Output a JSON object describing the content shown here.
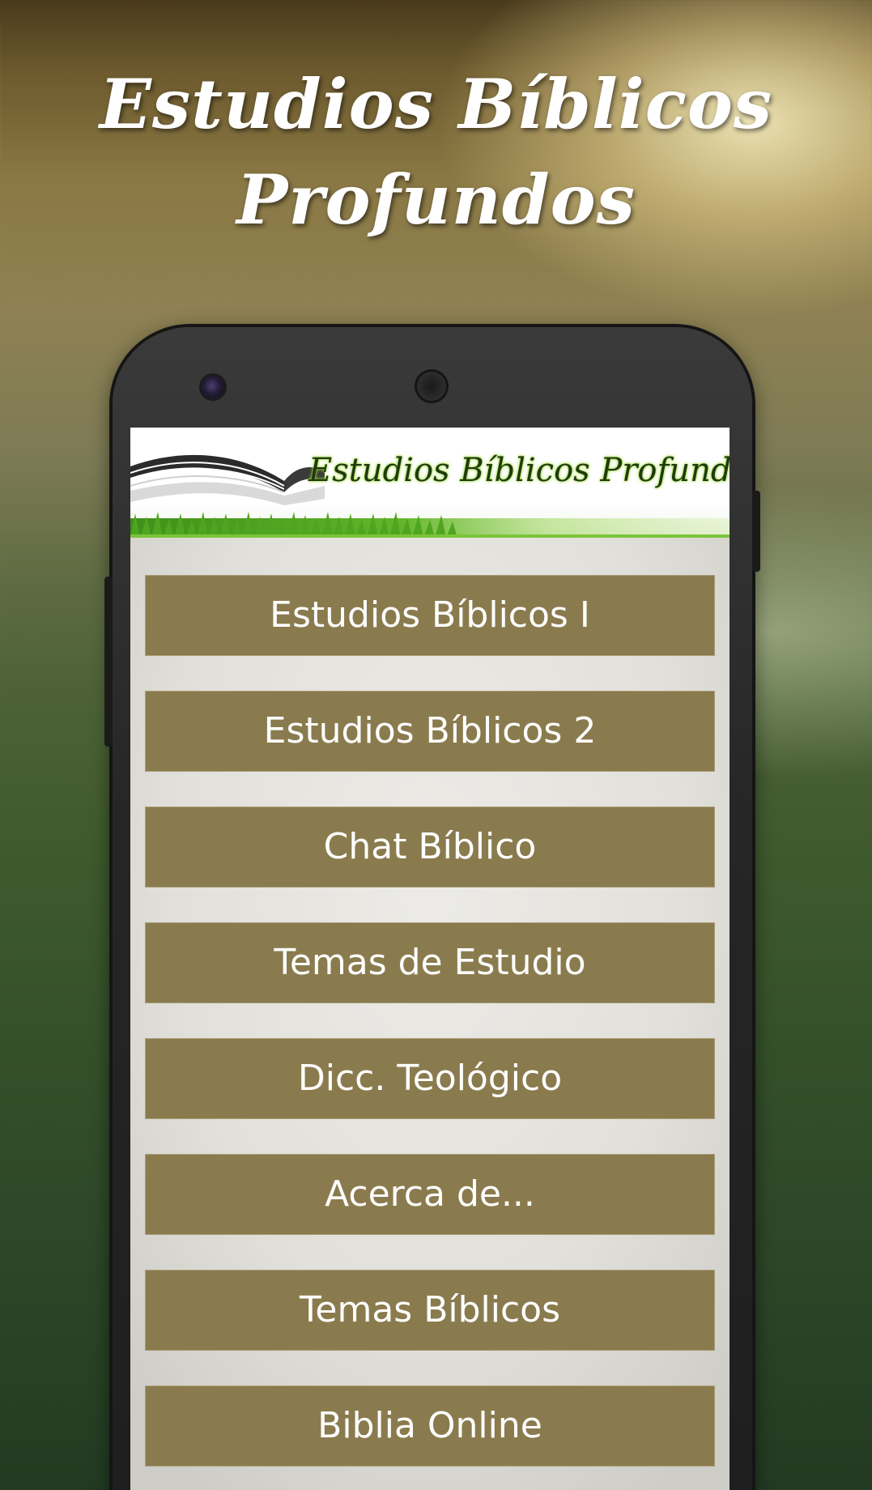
{
  "hero": {
    "title_line1": "Estudios Bíblicos",
    "title_line2": "Profundos"
  },
  "banner": {
    "title": "Estudios Bíblicos Profundos"
  },
  "menu": {
    "items": [
      {
        "label": "Estudios Bíblicos I"
      },
      {
        "label": "Estudios Bíblicos 2"
      },
      {
        "label": "Chat Bíblico"
      },
      {
        "label": "Temas de Estudio"
      },
      {
        "label": "Dicc. Teológico"
      },
      {
        "label": "Acerca de..."
      },
      {
        "label": "Temas Bíblicos"
      },
      {
        "label": "Biblia Online"
      }
    ]
  },
  "colors": {
    "button_background": "#8a7b4e",
    "button_text": "#ffffff",
    "banner_title": "#1f3a0f",
    "banner_glow": "#9fdc38"
  },
  "icons": {
    "banner_book": "open-book-icon",
    "banner_grass": "grass-strip"
  }
}
